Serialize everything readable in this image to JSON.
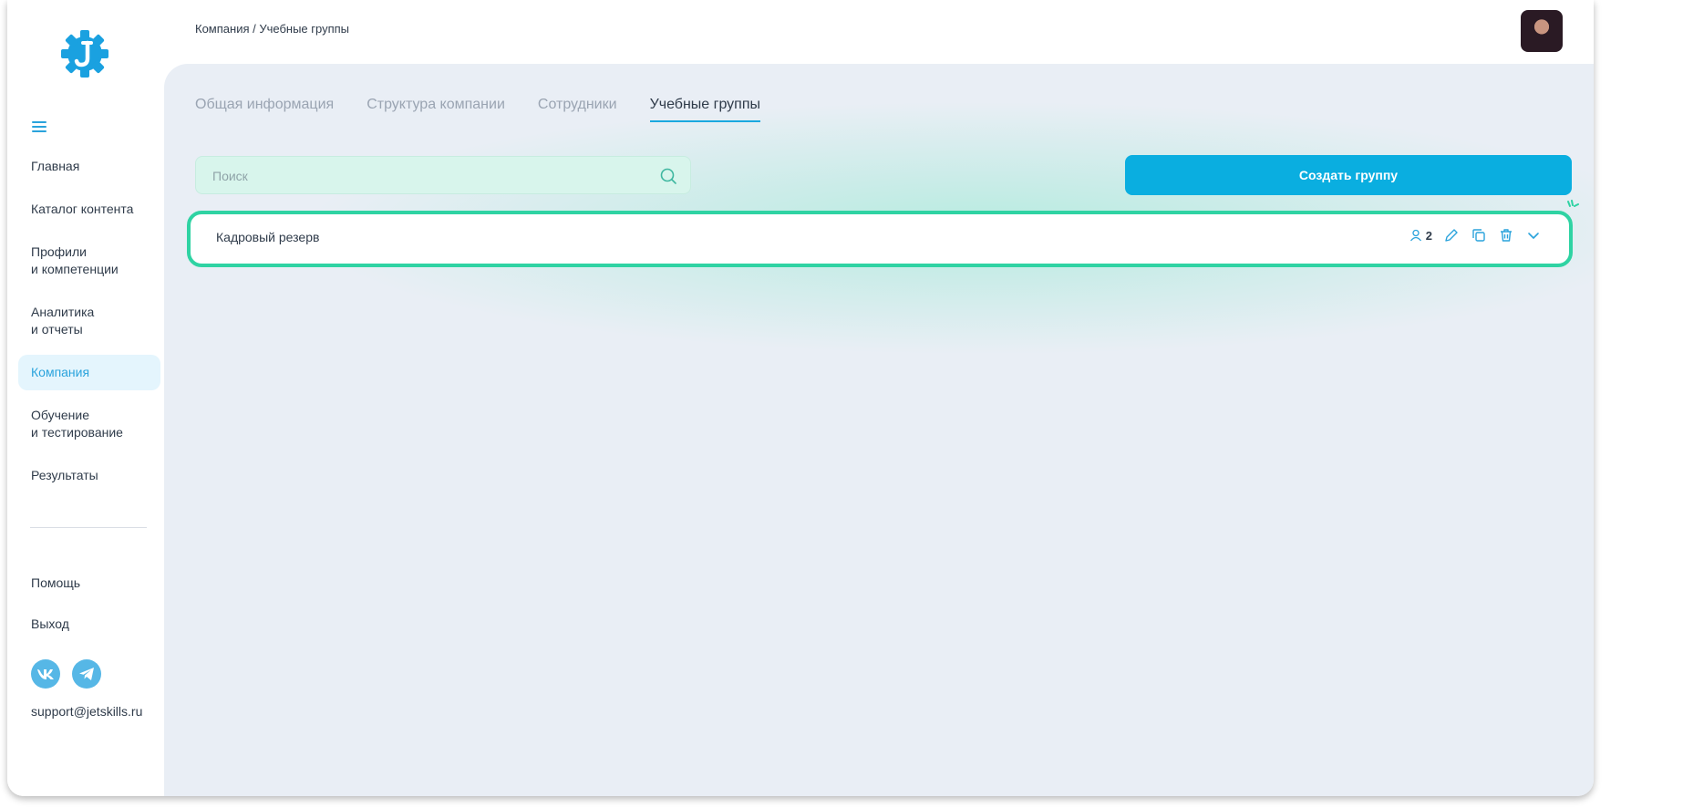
{
  "breadcrumb": "Компания / Учебные группы",
  "sidebar": {
    "items": [
      {
        "label": "Главная"
      },
      {
        "label": "Каталог контента"
      },
      {
        "label": "Профили\nи компетенции"
      },
      {
        "label": "Аналитика\nи отчеты"
      },
      {
        "label": "Компания",
        "active": true
      },
      {
        "label": "Обучение\nи тестирование"
      },
      {
        "label": "Результаты"
      }
    ],
    "help": "Помощь",
    "logout": "Выход",
    "social": [
      {
        "icon": "vk-icon"
      },
      {
        "icon": "telegram-icon"
      }
    ],
    "email": "support@jetskills.ru"
  },
  "tabs": [
    {
      "label": "Общая информация"
    },
    {
      "label": "Структура компании"
    },
    {
      "label": "Сотрудники"
    },
    {
      "label": "Учебные группы",
      "active": true
    }
  ],
  "search": {
    "placeholder": "Поиск",
    "value": ""
  },
  "create_button": "Создать группу",
  "groups": [
    {
      "title": "Кадровый резерв",
      "members": "2"
    }
  ],
  "colors": {
    "accent": "#0aaee0",
    "highlight": "#2fd3a3",
    "panel": "#e9eef5"
  }
}
